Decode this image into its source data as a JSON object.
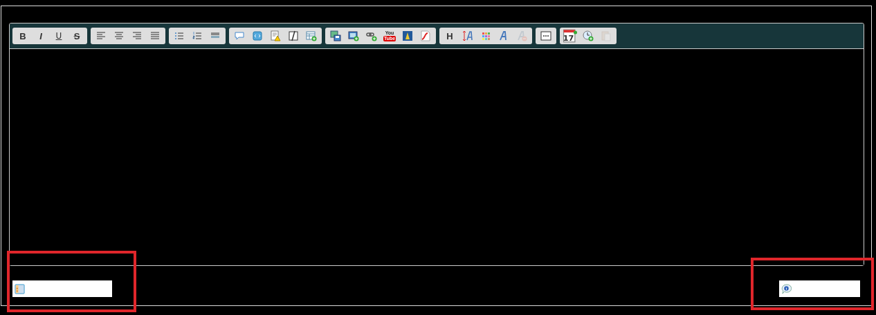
{
  "toolbar": {
    "groups": [
      {
        "buttons": [
          {
            "kind": "bold",
            "label": "B",
            "disabled": false
          },
          {
            "kind": "italic",
            "label": "I",
            "disabled": false
          },
          {
            "kind": "underline",
            "label": "U",
            "disabled": false
          },
          {
            "kind": "strike",
            "label": "S",
            "disabled": false
          }
        ]
      },
      {
        "buttons": [
          {
            "kind": "align-left",
            "disabled": false
          },
          {
            "kind": "align-center",
            "disabled": false
          },
          {
            "kind": "align-right",
            "disabled": false
          },
          {
            "kind": "justify",
            "disabled": false
          }
        ]
      },
      {
        "buttons": [
          {
            "kind": "bullets",
            "disabled": false
          },
          {
            "kind": "numbers",
            "disabled": false
          },
          {
            "kind": "rule",
            "disabled": false
          }
        ]
      },
      {
        "buttons": [
          {
            "kind": "quote",
            "disabled": false
          },
          {
            "kind": "code",
            "disabled": false
          },
          {
            "kind": "warning",
            "disabled": false
          },
          {
            "kind": "spoiler",
            "disabled": false
          },
          {
            "kind": "table",
            "disabled": false
          }
        ]
      },
      {
        "buttons": [
          {
            "kind": "image-save",
            "disabled": false
          },
          {
            "kind": "image-add",
            "disabled": false
          },
          {
            "kind": "link",
            "disabled": false
          },
          {
            "kind": "video",
            "label": "You",
            "label2": "Tube",
            "disabled": false
          },
          {
            "kind": "badge",
            "disabled": false
          },
          {
            "kind": "flash",
            "disabled": false
          }
        ]
      },
      {
        "buttons": [
          {
            "kind": "heading",
            "label": "H",
            "disabled": false
          },
          {
            "kind": "font-size",
            "disabled": false
          },
          {
            "kind": "palette",
            "disabled": false
          },
          {
            "kind": "font",
            "disabled": false
          },
          {
            "kind": "remove-format",
            "disabled": true
          }
        ]
      },
      {
        "buttons": [
          {
            "kind": "more",
            "disabled": false
          }
        ]
      },
      {
        "buttons": [
          {
            "kind": "calendar",
            "label": "17",
            "disabled": false
          },
          {
            "kind": "clock",
            "disabled": false
          },
          {
            "kind": "paste",
            "disabled": true
          }
        ]
      }
    ]
  },
  "footer": {
    "left_field": {
      "kind": "panel"
    },
    "right_field": {
      "kind": "info"
    }
  }
}
